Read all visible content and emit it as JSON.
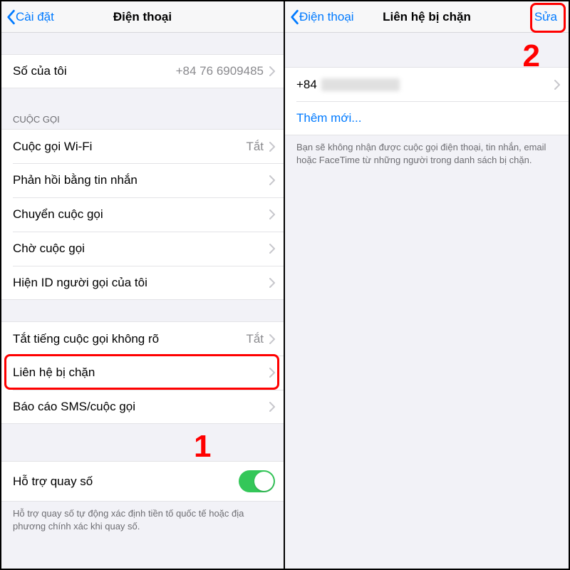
{
  "left": {
    "nav": {
      "back": "Cài đặt",
      "title": "Điện thoại"
    },
    "my_number": {
      "label": "Số của tôi",
      "value": "+84 76 6909485"
    },
    "calls_header": "CUỘC GỌI",
    "rows": {
      "wifi": {
        "label": "Cuộc gọi Wi-Fi",
        "value": "Tắt"
      },
      "respond": {
        "label": "Phản hồi bằng tin nhắn"
      },
      "forward": {
        "label": "Chuyển cuộc gọi"
      },
      "waiting": {
        "label": "Chờ cuộc gọi"
      },
      "callerid": {
        "label": "Hiện ID người gọi của tôi"
      },
      "silence": {
        "label": "Tắt tiếng cuộc gọi không rõ",
        "value": "Tắt"
      },
      "blocked": {
        "label": "Liên hệ bị chặn"
      },
      "report": {
        "label": "Báo cáo SMS/cuộc gọi"
      },
      "dial": {
        "label": "Hỗ trợ quay số"
      }
    },
    "dial_footer": "Hỗ trợ quay số tự động xác định tiền tố quốc tế hoặc địa phương chính xác khi quay số.",
    "step": "1"
  },
  "right": {
    "nav": {
      "back": "Điện thoại",
      "title": "Liên hệ bị chặn",
      "edit": "Sửa"
    },
    "entry_prefix": "+84",
    "add_new": "Thêm mới...",
    "footer": "Bạn sẽ không nhận được cuộc gọi điện thoại, tin nhắn, email hoặc FaceTime từ những người trong danh sách bị chặn.",
    "step": "2"
  }
}
